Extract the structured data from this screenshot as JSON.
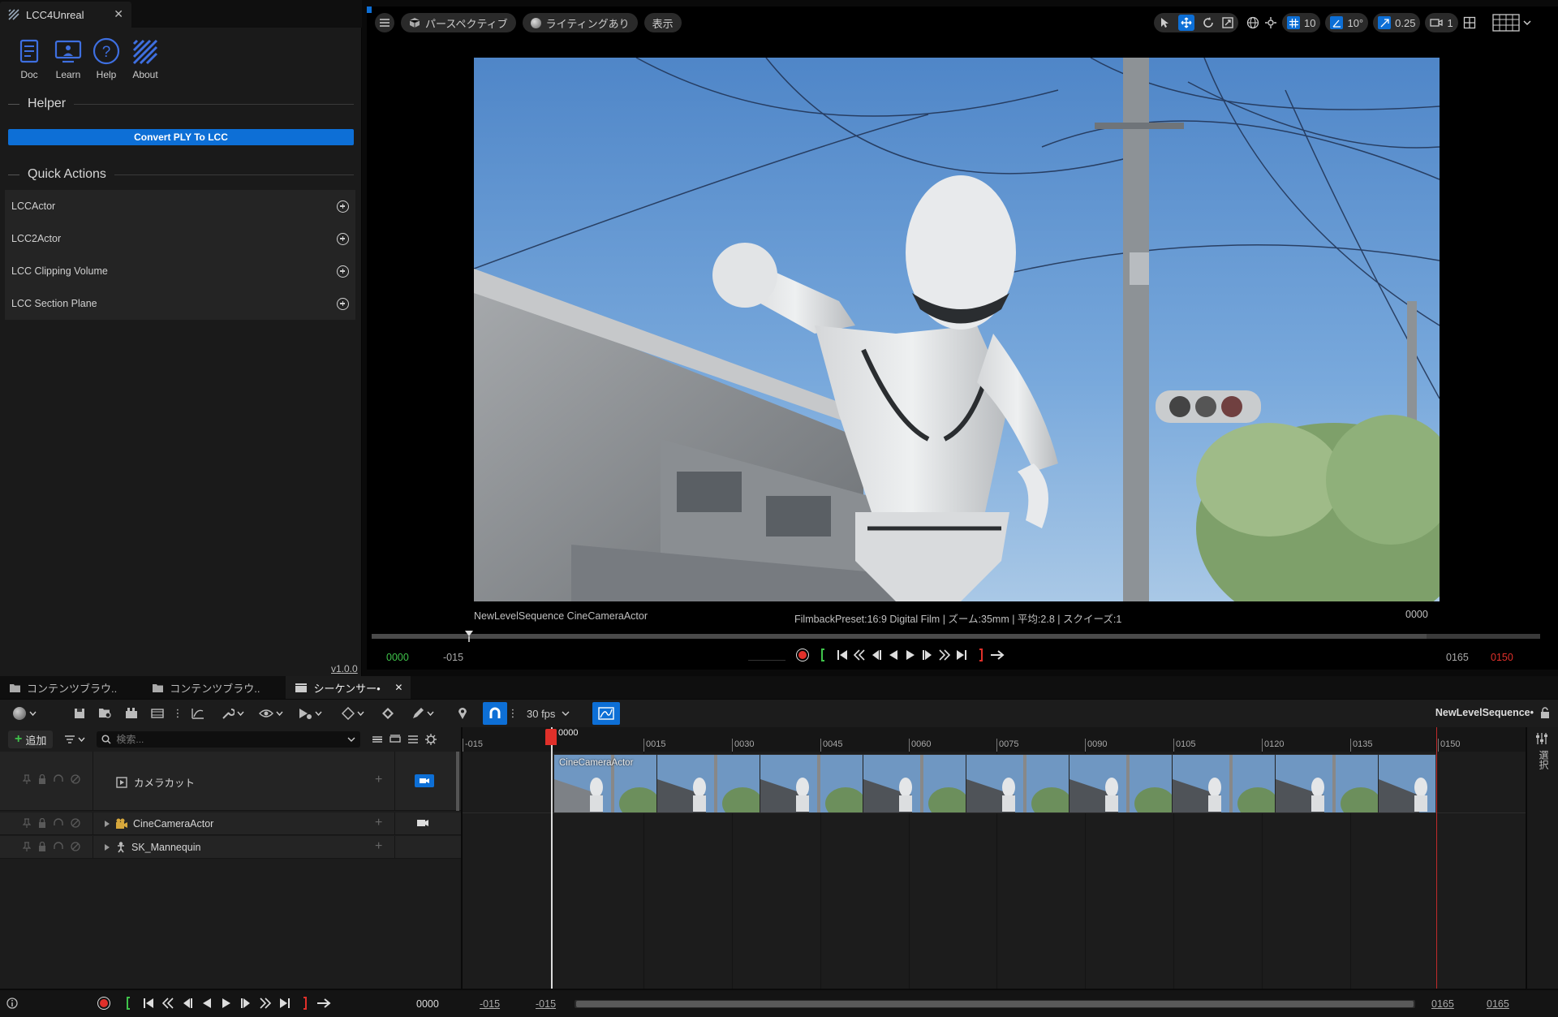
{
  "left_panel": {
    "tab_title": "LCC4Unreal",
    "tools": [
      {
        "label": "Doc",
        "icon": "doc-icon"
      },
      {
        "label": "Learn",
        "icon": "learn-icon"
      },
      {
        "label": "Help",
        "icon": "help-icon"
      },
      {
        "label": "About",
        "icon": "about-icon"
      }
    ],
    "helper_title": "Helper",
    "convert_button": "Convert PLY To LCC",
    "quick_actions_title": "Quick Actions",
    "quick_actions": [
      "LCCActor",
      "LCC2Actor",
      "LCC Clipping Volume",
      "LCC Section Plane"
    ],
    "version": "v1.0.0"
  },
  "viewport": {
    "perspective_label": "パースペクティブ",
    "lighting_label": "ライティングあり",
    "show_label": "表示",
    "grid_snap": "10",
    "rotation_snap": "10°",
    "scale_snap": "0.25",
    "camera_speed": "1",
    "caption_left": "NewLevelSequence  CineCameraActor",
    "caption_center": "FilmbackPreset:16:9 Digital Film | ズーム:35mm | 平均:2.8 | スクイーズ:1",
    "caption_frame": "0000",
    "start_frame": "0000",
    "range_start": "-015",
    "range_end": "0165",
    "end_frame": "0150"
  },
  "bottom_tabs": [
    {
      "label": "コンテンツブラウ..",
      "icon": "folder-icon"
    },
    {
      "label": "コンテンツブラウ..",
      "icon": "folder-icon"
    },
    {
      "label": "シーケンサー•",
      "icon": "clapper-icon"
    }
  ],
  "sequencer": {
    "fps": "30 fps",
    "sequence_name": "NewLevelSequence•",
    "add_label": "追加",
    "search_placeholder": "検索...",
    "tracks": [
      {
        "name": "カメラカット",
        "icon": "camera-cut-icon"
      },
      {
        "name": "CineCameraActor",
        "icon": "camera-actor-icon"
      },
      {
        "name": "SK_Mannequin",
        "icon": "mannequin-icon"
      }
    ],
    "ruler_labels": [
      "-015",
      "0000",
      "0015",
      "0030",
      "0045",
      "0060",
      "0075",
      "0090",
      "0105",
      "0120",
      "0135",
      "0150"
    ],
    "section_label": "CineCameraActor",
    "side_label": "選択",
    "current_frame": "0000",
    "view_start": "-015",
    "view_start2": "-015",
    "view_end": "0165",
    "view_end2": "0165"
  },
  "colors": {
    "accent": "#0d6fd6",
    "record": "#e0302a",
    "start_green": "#3fc24a"
  }
}
